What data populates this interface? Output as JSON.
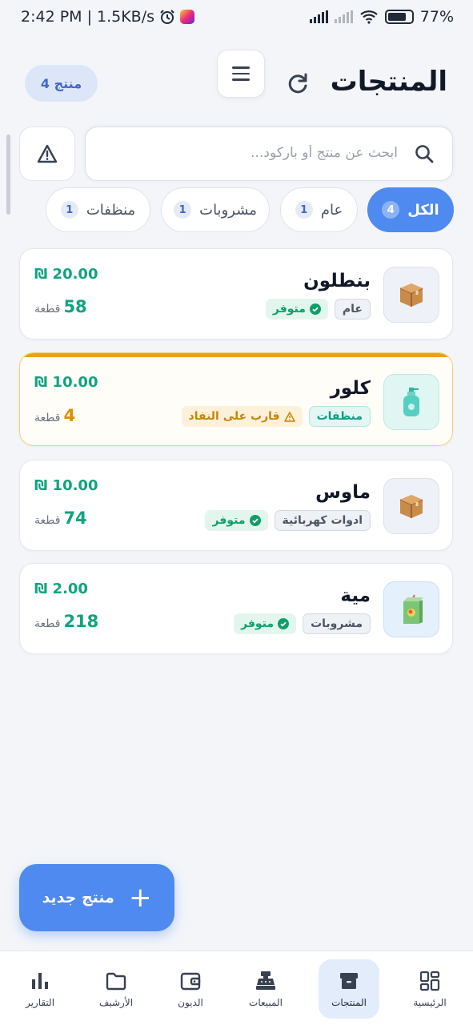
{
  "status_bar": {
    "time": "2:42 PM",
    "speed": "| 1.5KB/s",
    "battery": "77%"
  },
  "header": {
    "title": "المنتجات",
    "count_badge": "4 منتج",
    "menu_icon": "hamburger-menu-icon",
    "refresh_icon": "refresh-icon"
  },
  "search": {
    "placeholder": "ابحث عن منتج أو باركود...",
    "value": ""
  },
  "filters": [
    {
      "label": "الكل",
      "count": "4",
      "active": true
    },
    {
      "label": "عام",
      "count": "1",
      "active": false
    },
    {
      "label": "مشروبات",
      "count": "1",
      "active": false
    },
    {
      "label": "منظفات",
      "count": "1",
      "active": false
    }
  ],
  "products": [
    {
      "name": "بنطلون",
      "category": "عام",
      "status": "متوفر",
      "status_type": "ok",
      "price": "₪ 20.00",
      "qty": "58",
      "unit": "قطعة",
      "thumb_icon": "box-icon"
    },
    {
      "name": "كلور",
      "category": "منظفات",
      "status": "قارب على النفاد",
      "status_type": "warn",
      "price": "₪ 10.00",
      "qty": "4",
      "unit": "قطعة",
      "thumb_icon": "soap-bottle-icon"
    },
    {
      "name": "ماوس",
      "category": "ادوات كهربائية",
      "status": "متوفر",
      "status_type": "ok",
      "price": "₪ 10.00",
      "qty": "74",
      "unit": "قطعة",
      "thumb_icon": "box-icon"
    },
    {
      "name": "مية",
      "category": "مشروبات",
      "status": "متوفر",
      "status_type": "ok",
      "price": "₪ 2.00",
      "qty": "218",
      "unit": "قطعة",
      "thumb_icon": "juice-box-icon"
    }
  ],
  "fab": {
    "label": "منتج جديد"
  },
  "nav": [
    {
      "label": "الرئيسية",
      "icon": "dashboard-grid-icon"
    },
    {
      "label": "المنتجات",
      "icon": "archive-box-icon",
      "active": true
    },
    {
      "label": "المبيعات",
      "icon": "cash-register-icon"
    },
    {
      "label": "الديون",
      "icon": "wallet-icon"
    },
    {
      "label": "الأرشيف",
      "icon": "folder-icon"
    },
    {
      "label": "التقارير",
      "icon": "bar-chart-icon"
    }
  ],
  "colors": {
    "accent": "#4f8af0",
    "success": "#10a37f",
    "warning": "#e8a317"
  }
}
